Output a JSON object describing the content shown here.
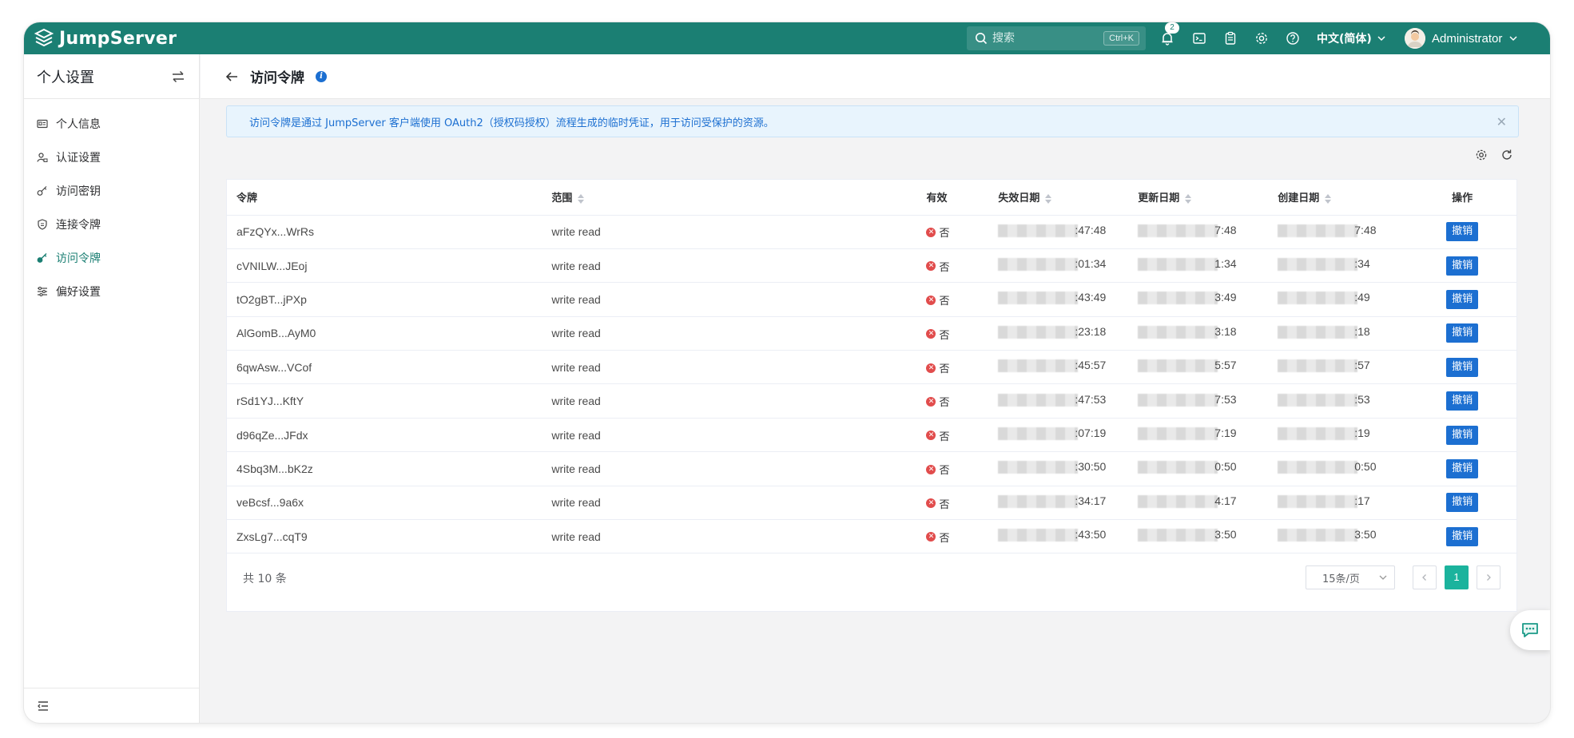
{
  "app": {
    "brand": "JumpServer",
    "search_placeholder": "搜索",
    "search_shortcut": "Ctrl+K",
    "notification_count": "2",
    "language": "中文(简体)",
    "user_name": "Administrator"
  },
  "sidebar": {
    "title": "个人设置",
    "items": [
      {
        "label": "个人信息",
        "icon": "id-card-icon",
        "active": false
      },
      {
        "label": "认证设置",
        "icon": "user-lock-icon",
        "active": false
      },
      {
        "label": "访问密钥",
        "icon": "key-icon",
        "active": false
      },
      {
        "label": "连接令牌",
        "icon": "shield-doc-icon",
        "active": false
      },
      {
        "label": "访问令牌",
        "icon": "key-icon",
        "active": true
      },
      {
        "label": "偏好设置",
        "icon": "sliders-icon",
        "active": false
      }
    ]
  },
  "page": {
    "title": "访问令牌",
    "alert": "访问令牌是通过 JumpServer 客户端使用 OAuth2（授权码授权）流程生成的临时凭证，用于访问受保护的资源。"
  },
  "table": {
    "columns": [
      "令牌",
      "范围",
      "有效",
      "失效日期",
      "更新日期",
      "创建日期",
      "操作"
    ],
    "revoke_label": "撤销",
    "rows": [
      {
        "token": "aFzQYx...WrRs",
        "scope": "write read",
        "valid": "否",
        "expire_tail": ":47:48",
        "update_tail": "7:48",
        "create_tail": "7:48"
      },
      {
        "token": "cVNILW...JEoj",
        "scope": "write read",
        "valid": "否",
        "expire_tail": ":01:34",
        "update_tail": "1:34",
        "create_tail": ":34"
      },
      {
        "token": "tO2gBT...jPXp",
        "scope": "write read",
        "valid": "否",
        "expire_tail": ":43:49",
        "update_tail": "3:49",
        "create_tail": ":49"
      },
      {
        "token": "AlGomB...AyM0",
        "scope": "write read",
        "valid": "否",
        "expire_tail": ":23:18",
        "update_tail": "3:18",
        "create_tail": ":18"
      },
      {
        "token": "6qwAsw...VCof",
        "scope": "write read",
        "valid": "否",
        "expire_tail": ":45:57",
        "update_tail": "5:57",
        "create_tail": ":57"
      },
      {
        "token": "rSd1YJ...KftY",
        "scope": "write read",
        "valid": "否",
        "expire_tail": ":47:53",
        "update_tail": "7:53",
        "create_tail": ":53"
      },
      {
        "token": "d96qZe...JFdx",
        "scope": "write read",
        "valid": "否",
        "expire_tail": ":07:19",
        "update_tail": "7:19",
        "create_tail": ":19"
      },
      {
        "token": "4Sbq3M...bK2z",
        "scope": "write read",
        "valid": "否",
        "expire_tail": ":30:50",
        "update_tail": "0:50",
        "create_tail": "0:50"
      },
      {
        "token": "veBcsf...9a6x",
        "scope": "write read",
        "valid": "否",
        "expire_tail": ":34:17",
        "update_tail": "4:17",
        "create_tail": ":17"
      },
      {
        "token": "ZxsLg7...cqT9",
        "scope": "write read",
        "valid": "否",
        "expire_tail": ":43:50",
        "update_tail": "3:50",
        "create_tail": "3:50"
      }
    ]
  },
  "pagination": {
    "total": "共 10 条",
    "page_size": "15条/页",
    "current_page": "1"
  },
  "colors": {
    "topbar": "#1b7f73",
    "active": "#1b7f73",
    "primary": "#1c6fd1",
    "page_active": "#1bb39d"
  }
}
